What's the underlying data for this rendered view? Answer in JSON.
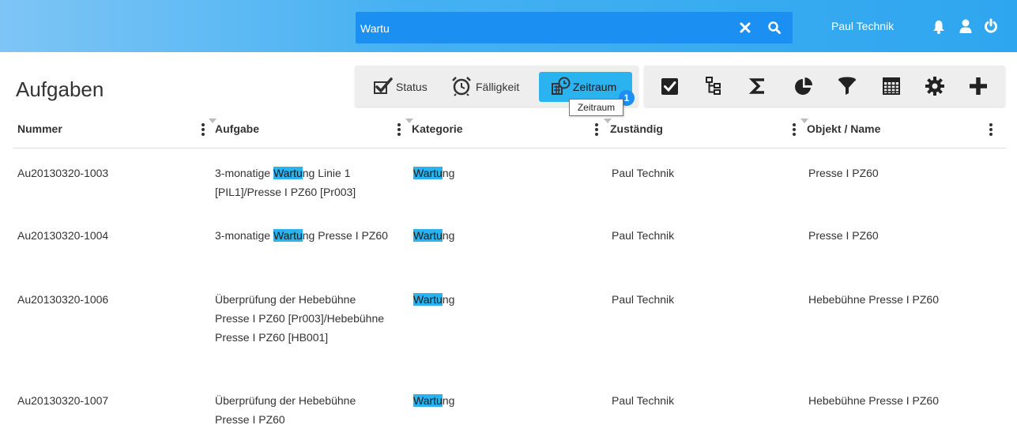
{
  "topbar": {
    "search_value": "Wartu",
    "username": "Paul Technik"
  },
  "page": {
    "title": "Aufgaben"
  },
  "filters": {
    "status_label": "Status",
    "due_label": "Fälligkeit",
    "range_label": "Zeitraum",
    "range_badge": "1",
    "tooltip": "Zeitraum"
  },
  "toolbar": {
    "icons": [
      "checkbox-icon",
      "tree-icon",
      "sum-icon",
      "pie-chart-icon",
      "filter-icon",
      "table-icon",
      "gear-icon",
      "plus-icon"
    ]
  },
  "table": {
    "columns": [
      "Nummer",
      "Aufgabe",
      "Kategorie",
      "Zuständig",
      "Objekt / Name"
    ],
    "highlight": "Wartu",
    "rows": [
      {
        "number": "Au20130320-1003",
        "task_pre": "3-monatige ",
        "task_hl": "Wartu",
        "task_post": "ng Linie 1 [PIL1]/Presse I PZ60 [Pr003]",
        "category_hl": "Wartu",
        "category_post": "ng",
        "owner": "Paul Technik",
        "object": "Presse I PZ60"
      },
      {
        "number": "Au20130320-1004",
        "task_pre": "3-monatige ",
        "task_hl": "Wartu",
        "task_post": "ng Presse I PZ60",
        "category_hl": "Wartu",
        "category_post": "ng",
        "owner": "Paul Technik",
        "object": "Presse I PZ60"
      },
      {
        "number": "Au20130320-1006",
        "task": "Überprüfung der Hebebühne Presse I PZ60 [Pr003]/Hebebühne Presse I PZ60 [HB001]",
        "category_hl": "Wartu",
        "category_post": "ng",
        "owner": "Paul Technik",
        "object": "Hebebühne Presse I PZ60"
      },
      {
        "number": "Au20130320-1007",
        "task": "Überprüfung der Hebebühne Presse I PZ60",
        "category_hl": "Wartu",
        "category_post": "ng",
        "owner": "Paul Technik",
        "object": "Hebebühne Presse I PZ60"
      }
    ]
  },
  "colors": {
    "topbar": "#2ea6ef",
    "search_bg": "#1c8ff2",
    "highlight": "#2bb3f0"
  }
}
